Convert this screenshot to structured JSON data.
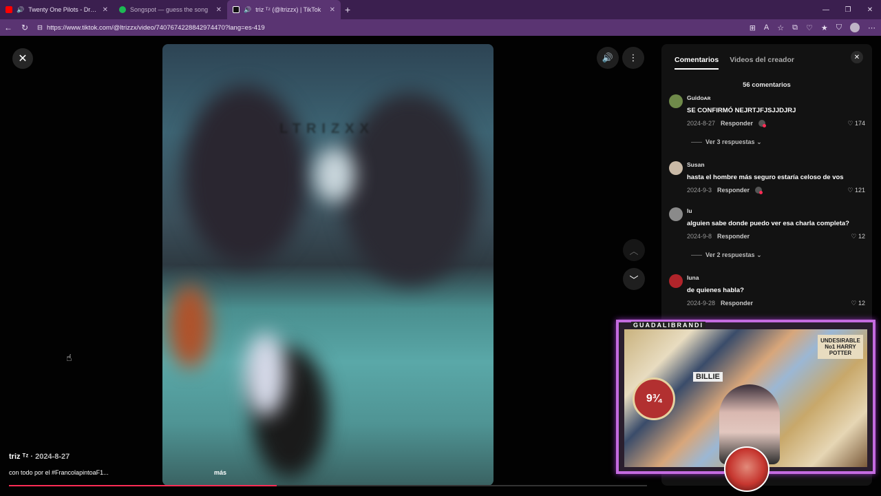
{
  "browser": {
    "tabs": [
      {
        "title": "Twenty One Pilots - Drag Path",
        "favicon_color": "#ff0000",
        "audio": true,
        "active": false
      },
      {
        "title": "Songspot — guess the song",
        "favicon_color": "#1db954",
        "audio": false,
        "active": false
      },
      {
        "title": "triz ᵀᶻ (@ltrizzx) | TikTok",
        "favicon_color": "#111111",
        "audio": true,
        "active": true
      }
    ],
    "url": "https://www.tiktok.com/@ltrizzx/video/7407674228842974470?lang=es-419"
  },
  "video": {
    "watermark": "LTRIZXX",
    "author": "triz ᵀᶻ",
    "date": "· 2024-8-27",
    "description": "con todo por el #FrancolapintoaF1...",
    "more_label": "más",
    "progress": 0.42
  },
  "panel": {
    "tab_comments": "Comentarios",
    "tab_creator": "Videos del creador",
    "count": "56 comentarios",
    "comments": [
      {
        "name": "Guidoᴀʀ",
        "text": "SE CONFIRMÓ NEJRTJFJSJJDJRJ",
        "date": "2024-8-27",
        "reply": "Responder",
        "likes": "174",
        "replies": "Ver 3 respuestas",
        "avatar_color": "#6f8a4a",
        "creator_reply": true
      },
      {
        "name": "Susan",
        "text": "hasta el hombre más seguro estaría celoso de vos",
        "date": "2024-9-3",
        "reply": "Responder",
        "likes": "121",
        "replies": "",
        "avatar_color": "#c9b9a6",
        "creator_reply": true
      },
      {
        "name": "lu",
        "text": "alguien sabe donde puedo ver esa charla completa?",
        "date": "2024-9-8",
        "reply": "Responder",
        "likes": "12",
        "replies": "Ver 2 respuestas",
        "avatar_color": "#8a8a8a",
        "creator_reply": false
      },
      {
        "name": "luna",
        "text": "de quienes habla?",
        "date": "2024-9-28",
        "reply": "Responder",
        "likes": "12",
        "replies": "",
        "avatar_color": "#b0242a",
        "creator_reply": false
      }
    ]
  },
  "overlay": {
    "label": "GUADALIBRANDI",
    "platform": "9¾",
    "billie": "BILLIE",
    "poster": "UNDESIRABLE No1 HARRY POTTER"
  }
}
